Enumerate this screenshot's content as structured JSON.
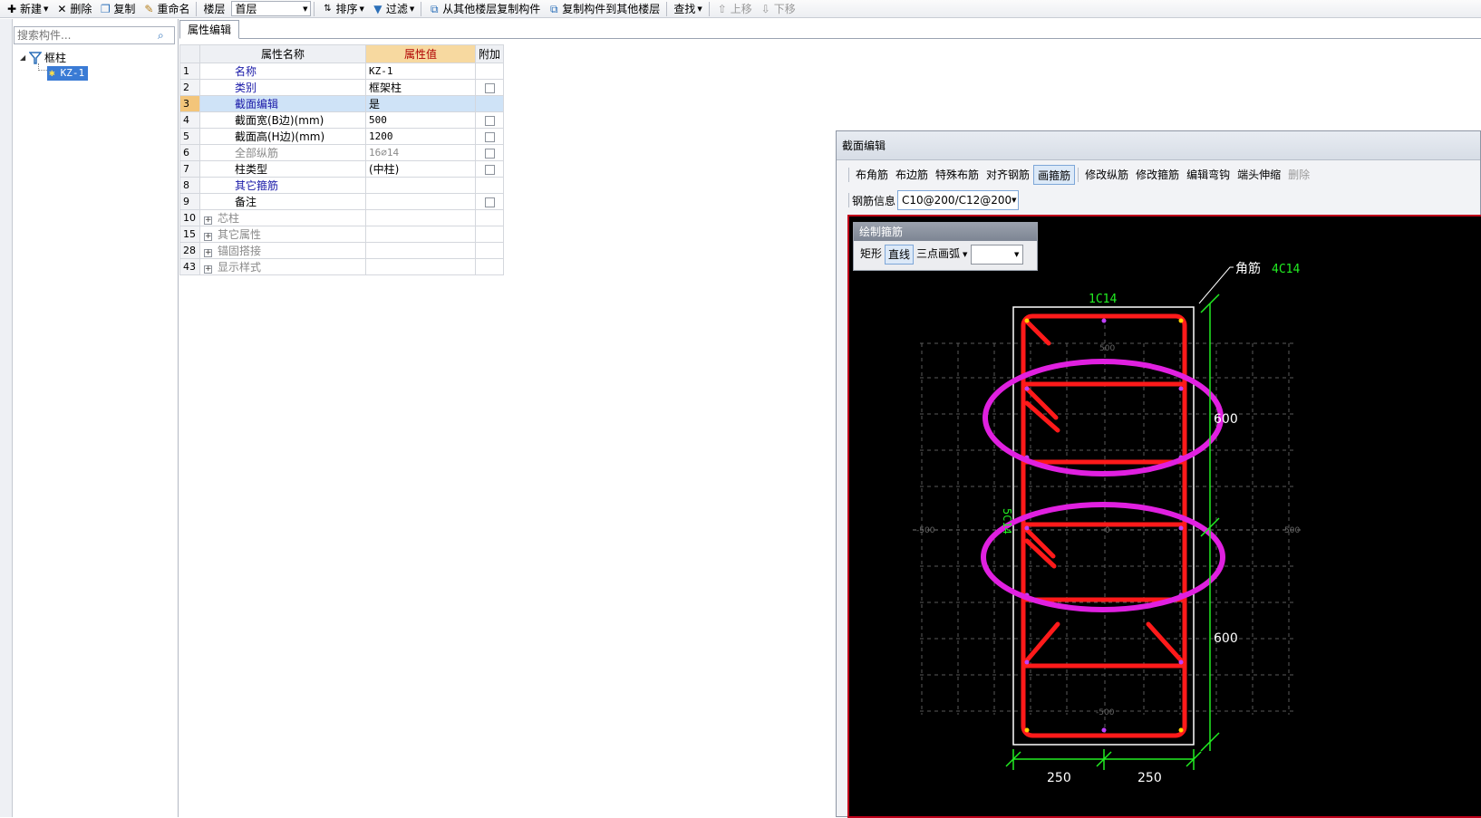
{
  "toolbar": {
    "new_label": "新建",
    "delete_label": "删除",
    "copy_label": "复制",
    "rename_label": "重命名",
    "floor_label": "楼层",
    "floor_value": "首层",
    "sort_label": "排序",
    "filter_label": "过滤",
    "copy_from_label": "从其他楼层复制构件",
    "copy_to_label": "复制构件到其他楼层",
    "find_label": "查找",
    "up_label": "上移",
    "down_label": "下移"
  },
  "search": {
    "placeholder": "搜索构件..."
  },
  "tree": {
    "root_label": "框柱",
    "child_label": "KZ-1"
  },
  "tab": {
    "label": "属性编辑"
  },
  "grid": {
    "headers": {
      "name": "属性名称",
      "value": "属性值",
      "extra": "附加"
    },
    "rows": [
      {
        "num": "1",
        "name": "名称",
        "value": "KZ-1"
      },
      {
        "num": "2",
        "name": "类别",
        "value": "框架柱"
      },
      {
        "num": "3",
        "name": "截面编辑",
        "value": "是"
      },
      {
        "num": "4",
        "name": "截面宽(B边)(mm)",
        "value": "500"
      },
      {
        "num": "5",
        "name": "截面高(H边)(mm)",
        "value": "1200"
      },
      {
        "num": "6",
        "name": "全部纵筋",
        "value": "16⌀14"
      },
      {
        "num": "7",
        "name": "柱类型",
        "value": "(中柱)"
      },
      {
        "num": "8",
        "name": "其它箍筋",
        "value": ""
      },
      {
        "num": "9",
        "name": "备注",
        "value": ""
      },
      {
        "num": "10",
        "name": "芯柱",
        "value": ""
      },
      {
        "num": "15",
        "name": "其它属性",
        "value": ""
      },
      {
        "num": "28",
        "name": "锚固搭接",
        "value": ""
      },
      {
        "num": "43",
        "name": "显示样式",
        "value": ""
      }
    ]
  },
  "dialog": {
    "title": "截面编辑",
    "tools": [
      "布角筋",
      "布边筋",
      "特殊布筋",
      "对齐钢筋",
      "画箍筋",
      "修改纵筋",
      "修改箍筋",
      "编辑弯钩",
      "端头伸缩",
      "删除"
    ],
    "rebar_label": "钢筋信息",
    "rebar_value": "C10@200/C12@200",
    "draw_panel": {
      "title": "绘制箍筋",
      "rect": "矩形",
      "line": "直线",
      "arc": "三点画弧"
    },
    "canvas": {
      "corner_label": "角筋",
      "corner_value": "4C14",
      "top_label": "1C14",
      "side_label": "5C14",
      "dim_600_top": "600",
      "dim_600_bottom": "600",
      "dim_250_left": "250",
      "dim_250_right": "250",
      "grid_500_top": "500",
      "grid_500_bottom": "-500",
      "grid_500_left": "-500",
      "grid_500_right": "500",
      "grid_0": "0"
    }
  },
  "colors": {
    "rebar": "#ff1a1a",
    "highlight": "#e020e0",
    "dim": "#22ee22",
    "selection": "#3a7bd5"
  }
}
